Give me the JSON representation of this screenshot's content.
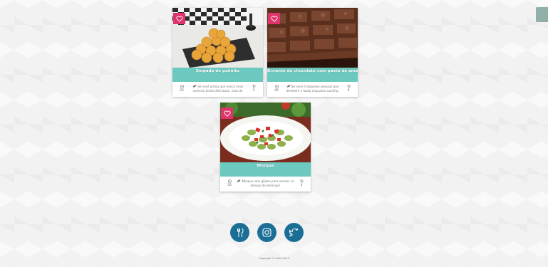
{
  "recipes": [
    {
      "title": "Empada de palmito",
      "time": "25",
      "servings": "3",
      "description": "Se você achou que nunca mais comeria tortas deliciosas, essa de palmito da"
    },
    {
      "title": "Brownie de chocolate com pasta de amendoim",
      "time": "45",
      "servings": "9",
      "description": "Se você é daquelas pessoas que derretem o fazão enquanto cozinha, pode"
    },
    {
      "title": "Nhoque",
      "time": "30",
      "servings": "3",
      "description": "Nhoque sem glúten para arrasar no almoço de domingo!"
    }
  ],
  "footer": {
    "copyright": "Copyright © Hello 2019",
    "social_icons": [
      "foodie-icon",
      "instagram-icon",
      "twitter-icon"
    ]
  },
  "colors": {
    "title_band": "#6cc9c0",
    "favorite": "#e0336b",
    "social": "#1b6f96"
  }
}
